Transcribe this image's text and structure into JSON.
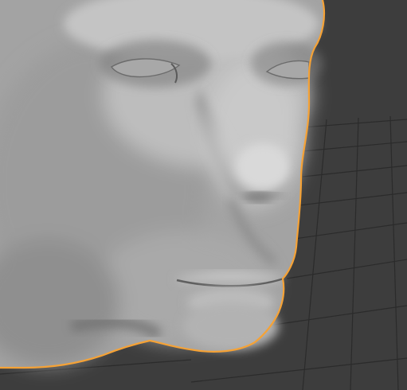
{
  "viewport": {
    "object_type": "head-mesh",
    "shading_mode": "solid",
    "overlays": [
      "floor-grid",
      "selection-outline"
    ],
    "selected": true
  },
  "colors": {
    "background": "#3d3d3d",
    "grid_line": "#2a2a2a",
    "grid_line_light": "#4a4a4a",
    "mesh_base": "#9a9a9a",
    "mesh_highlight": "#d6d6d6",
    "mesh_shadow": "#6a6a6a",
    "selection_outline": "#f5a236"
  }
}
